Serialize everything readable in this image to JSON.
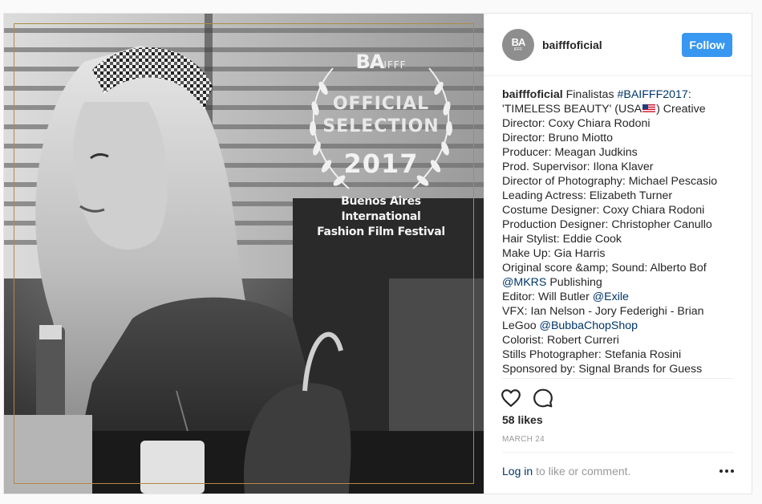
{
  "photo": {
    "laurel_brand": "BA",
    "laurel_brand_suffix": "IFFF",
    "laurel_line1": "OFFICIAL",
    "laurel_line2": "SELECTION",
    "laurel_year": "2017",
    "festival_line1": "Buenos Aires International",
    "festival_line2": "Fashion Film Festival"
  },
  "header": {
    "avatar_text": "BA",
    "avatar_suffix": "IFFF",
    "username": "baifffoficial",
    "follow_label": "Follow"
  },
  "caption": {
    "user": "baifffoficial",
    "l1_text": " Finalistas ",
    "l1_tag": "#BAIFFF2017",
    "l1_end": ":",
    "l2_a": "'TIMELESS BEAUTY' (USA",
    "l2_b": ") Creative",
    "lines": [
      "Director: Coxy Chiara Rodoni",
      "Director: Bruno Miotto",
      "Producer: Meagan Judkins",
      "Prod. Supervisor: Ilona Klaver",
      "Director of Photography: Michael Pescasio",
      "Leading Actress: Elizabeth Turner",
      "Costume Designer: Coxy Chiara Rodoni",
      "Production Designer: Christopher Canullo",
      "Hair Stylist: Eddie Cook",
      "Make Up: Gia Harris",
      "Original score &amp; Sound: Alberto Bof"
    ],
    "mkrs_tag": "@MKRS",
    "mkrs_rest": " Publishing",
    "editor_text": "Editor: Will Butler ",
    "editor_tag": "@Exile",
    "vfx_line": "VFX: Ian Nelson - Jory Federighi - Brian",
    "legoo_text": "LeGoo ",
    "legoo_tag": "@BubbaChopShop",
    "tail_lines": [
      "Colorist: Robert Curreri",
      "Stills Photographer: Stefania Rosini",
      "Sponsored by: Signal Brands for Guess"
    ]
  },
  "actions": {
    "like_icon": "heart-icon",
    "comment_icon": "comment-icon"
  },
  "likes": "58 likes",
  "date": "MARCH 24",
  "login": {
    "link": "Log in",
    "rest": "to like or comment."
  },
  "colors": {
    "follow": "#3897f0",
    "link": "#003569",
    "frame": "#b08a4a"
  }
}
